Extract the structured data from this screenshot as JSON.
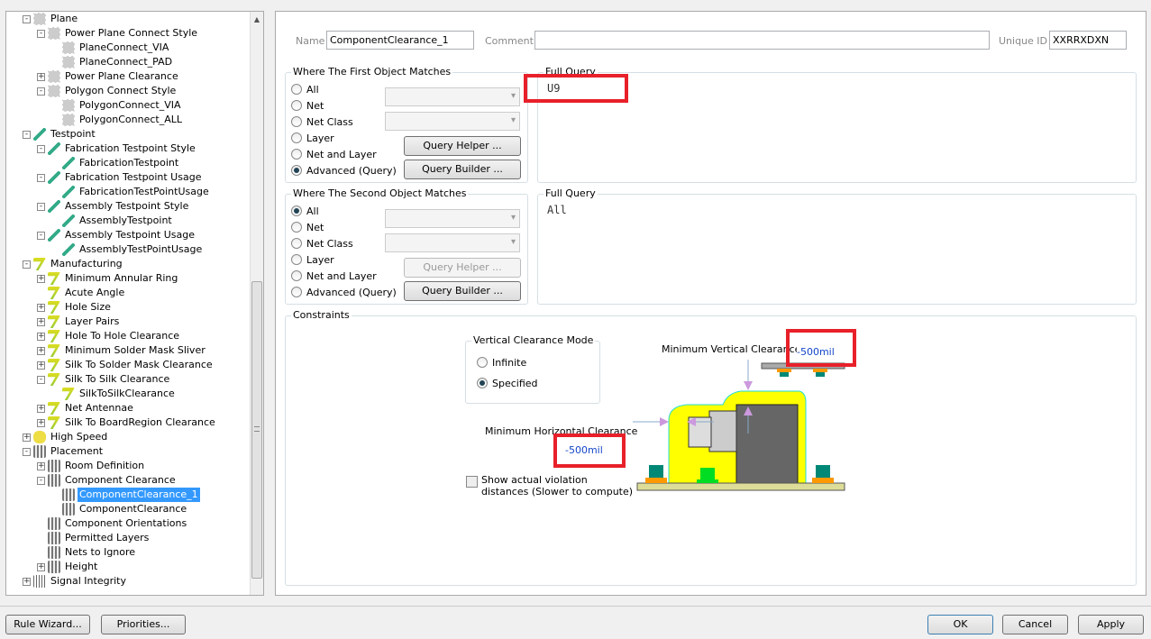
{
  "tree": [
    {
      "l": 0,
      "t": "Plane",
      "e": "-",
      "i": "plane"
    },
    {
      "l": 1,
      "t": "Power Plane Connect Style",
      "e": "-",
      "i": "plane"
    },
    {
      "l": 2,
      "t": "PlaneConnect_VIA",
      "e": "",
      "i": "plane"
    },
    {
      "l": 2,
      "t": "PlaneConnect_PAD",
      "e": "",
      "i": "plane"
    },
    {
      "l": 1,
      "t": "Power Plane Clearance",
      "e": "+",
      "i": "plane"
    },
    {
      "l": 1,
      "t": "Polygon Connect Style",
      "e": "-",
      "i": "plane"
    },
    {
      "l": 2,
      "t": "PolygonConnect_VIA",
      "e": "",
      "i": "plane"
    },
    {
      "l": 2,
      "t": "PolygonConnect_ALL",
      "e": "",
      "i": "plane"
    },
    {
      "l": 0,
      "t": "Testpoint",
      "e": "-",
      "i": "test"
    },
    {
      "l": 1,
      "t": "Fabrication Testpoint Style",
      "e": "-",
      "i": "test"
    },
    {
      "l": 2,
      "t": "FabricationTestpoint",
      "e": "",
      "i": "test"
    },
    {
      "l": 1,
      "t": "Fabrication Testpoint Usage",
      "e": "-",
      "i": "test"
    },
    {
      "l": 2,
      "t": "FabricationTestPointUsage",
      "e": "",
      "i": "test"
    },
    {
      "l": 1,
      "t": "Assembly Testpoint Style",
      "e": "-",
      "i": "test"
    },
    {
      "l": 2,
      "t": "AssemblyTestpoint",
      "e": "",
      "i": "test"
    },
    {
      "l": 1,
      "t": "Assembly Testpoint Usage",
      "e": "-",
      "i": "test"
    },
    {
      "l": 2,
      "t": "AssemblyTestPointUsage",
      "e": "",
      "i": "test"
    },
    {
      "l": 0,
      "t": "Manufacturing",
      "e": "-",
      "i": "mfg"
    },
    {
      "l": 1,
      "t": "Minimum Annular Ring",
      "e": "+",
      "i": "mfg"
    },
    {
      "l": 1,
      "t": "Acute Angle",
      "e": "",
      "i": "mfg"
    },
    {
      "l": 1,
      "t": "Hole Size",
      "e": "+",
      "i": "mfg"
    },
    {
      "l": 1,
      "t": "Layer Pairs",
      "e": "+",
      "i": "mfg"
    },
    {
      "l": 1,
      "t": "Hole To Hole Clearance",
      "e": "+",
      "i": "mfg"
    },
    {
      "l": 1,
      "t": "Minimum Solder Mask Sliver",
      "e": "+",
      "i": "mfg"
    },
    {
      "l": 1,
      "t": "Silk To Solder Mask Clearance",
      "e": "+",
      "i": "mfg"
    },
    {
      "l": 1,
      "t": "Silk To Silk Clearance",
      "e": "-",
      "i": "mfg"
    },
    {
      "l": 2,
      "t": "SilkToSilkClearance",
      "e": "",
      "i": "mfg"
    },
    {
      "l": 1,
      "t": "Net Antennae",
      "e": "+",
      "i": "mfg"
    },
    {
      "l": 1,
      "t": "Silk To BoardRegion Clearance",
      "e": "+",
      "i": "mfg"
    },
    {
      "l": 0,
      "t": "High Speed",
      "e": "+",
      "i": "hs"
    },
    {
      "l": 0,
      "t": "Placement",
      "e": "-",
      "i": "plc"
    },
    {
      "l": 1,
      "t": "Room Definition",
      "e": "+",
      "i": "plc"
    },
    {
      "l": 1,
      "t": "Component Clearance",
      "e": "-",
      "i": "plc"
    },
    {
      "l": 2,
      "t": "ComponentClearance_1",
      "e": "",
      "i": "plc",
      "sel": true
    },
    {
      "l": 2,
      "t": "ComponentClearance",
      "e": "",
      "i": "plc"
    },
    {
      "l": 1,
      "t": "Component Orientations",
      "e": "",
      "i": "plc"
    },
    {
      "l": 1,
      "t": "Permitted Layers",
      "e": "",
      "i": "plc"
    },
    {
      "l": 1,
      "t": "Nets to Ignore",
      "e": "",
      "i": "plc"
    },
    {
      "l": 1,
      "t": "Height",
      "e": "+",
      "i": "plc"
    },
    {
      "l": 0,
      "t": "Signal Integrity",
      "e": "+",
      "i": "si"
    }
  ],
  "rule": {
    "name_label": "Name",
    "name": "ComponentClearance_1",
    "comment_label": "Comment",
    "comment": "",
    "uid_label": "Unique ID",
    "uid": "XXRRXDXN"
  },
  "first": {
    "title": "Where The First Object Matches",
    "options": [
      "All",
      "Net",
      "Net Class",
      "Layer",
      "Net and Layer",
      "Advanced (Query)"
    ],
    "selected": 5,
    "query_helper": "Query Helper ...",
    "query_builder": "Query Builder ...",
    "full_query_label": "Full Query",
    "full_query": "U9"
  },
  "second": {
    "title": "Where The Second Object Matches",
    "options": [
      "All",
      "Net",
      "Net Class",
      "Layer",
      "Net and Layer",
      "Advanced (Query)"
    ],
    "selected": 0,
    "query_helper": "Query Helper ...",
    "query_builder": "Query Builder ...",
    "full_query_label": "Full Query",
    "full_query": "All"
  },
  "constraints": {
    "title": "Constraints",
    "mode_title": "Vertical Clearance Mode",
    "infinite": "Infinite",
    "specified": "Specified",
    "min_vertical_label": "Minimum Vertical Clearance",
    "min_vertical": "-500mil",
    "min_horizontal_label": "Minimum Horizontal Clearance",
    "min_horizontal": "-500mil",
    "show_violation": "Show actual violation",
    "show_violation2": "distances (Slower to compute)"
  },
  "footer": {
    "rule_wizard": "Rule Wizard...",
    "priorities": "Priorities...",
    "ok": "OK",
    "cancel": "Cancel",
    "apply": "Apply"
  }
}
